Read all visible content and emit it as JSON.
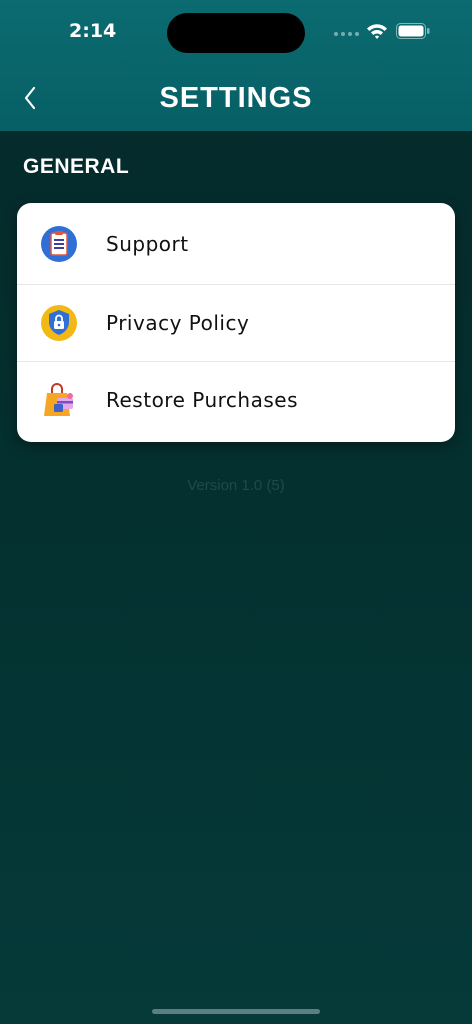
{
  "status_bar": {
    "time": "2:14",
    "wifi_icon": "wifi-icon",
    "battery_icon": "battery-icon"
  },
  "nav": {
    "title": "SETTINGS",
    "back_icon": "chevron-left-icon"
  },
  "section": {
    "label": "GENERAL"
  },
  "items": [
    {
      "label": "Support",
      "icon": "clipboard-icon"
    },
    {
      "label": "Privacy Policy",
      "icon": "shield-lock-icon"
    },
    {
      "label": "Restore Purchases",
      "icon": "shopping-bag-icon"
    }
  ],
  "version_text": "Version 1.0 (5)",
  "colors": {
    "header": "#0b6b70",
    "background": "#042f2e",
    "card": "#ffffff"
  }
}
